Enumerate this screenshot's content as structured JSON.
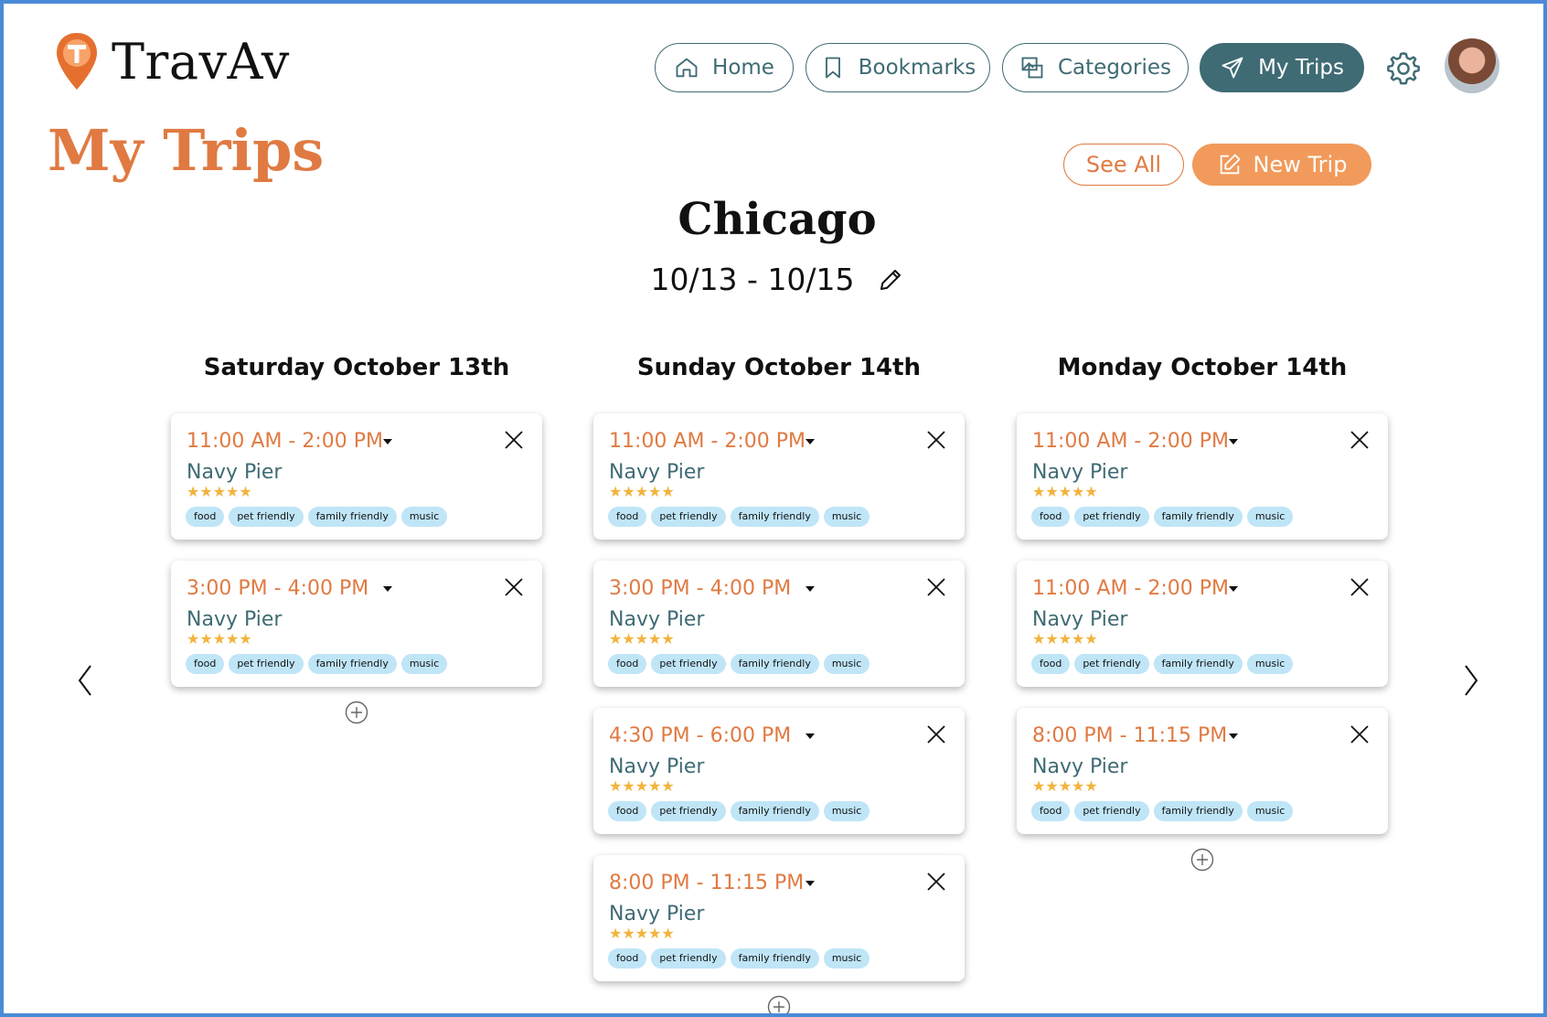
{
  "app": {
    "name": "TravAv"
  },
  "nav": {
    "home": "Home",
    "bookmarks": "Bookmarks",
    "categories": "Categories",
    "my_trips": "My Trips"
  },
  "page": {
    "title": "My Trips"
  },
  "actions": {
    "see_all": "See All",
    "new_trip": "New Trip"
  },
  "trip": {
    "city": "Chicago",
    "dates": "10/13 - 10/15"
  },
  "colors": {
    "accent": "#e07a42",
    "brand_teal": "#3f6b74",
    "tag_bg": "#bfe5f7",
    "star": "#f3b33d"
  },
  "days": [
    {
      "title": "Saturday October 13th",
      "events": [
        {
          "time": "11:00 AM - 2:00 PM",
          "name": "Navy Pier",
          "rating": 5,
          "stars": "★★★★★",
          "tags": [
            "food",
            "pet friendly",
            "family friendly",
            "music"
          ]
        },
        {
          "time": "3:00 PM - 4:00 PM",
          "name": "Navy Pier",
          "rating": 5,
          "stars": "★★★★★",
          "tags": [
            "food",
            "pet friendly",
            "family friendly",
            "music"
          ]
        }
      ]
    },
    {
      "title": "Sunday October 14th",
      "events": [
        {
          "time": "11:00 AM - 2:00 PM",
          "name": "Navy Pier",
          "rating": 5,
          "stars": "★★★★★",
          "tags": [
            "food",
            "pet friendly",
            "family friendly",
            "music"
          ]
        },
        {
          "time": "3:00 PM - 4:00 PM",
          "name": "Navy Pier",
          "rating": 5,
          "stars": "★★★★★",
          "tags": [
            "food",
            "pet friendly",
            "family friendly",
            "music"
          ]
        },
        {
          "time": "4:30 PM - 6:00 PM",
          "name": "Navy Pier",
          "rating": 5,
          "stars": "★★★★★",
          "tags": [
            "food",
            "pet friendly",
            "family friendly",
            "music"
          ]
        },
        {
          "time": "8:00 PM - 11:15 PM",
          "name": "Navy Pier",
          "rating": 5,
          "stars": "★★★★★",
          "tags": [
            "food",
            "pet friendly",
            "family friendly",
            "music"
          ]
        }
      ]
    },
    {
      "title": "Monday October 14th",
      "events": [
        {
          "time": "11:00 AM - 2:00 PM",
          "name": "Navy Pier",
          "rating": 5,
          "stars": "★★★★★",
          "tags": [
            "food",
            "pet friendly",
            "family friendly",
            "music"
          ]
        },
        {
          "time": "11:00 AM - 2:00 PM",
          "name": "Navy Pier",
          "rating": 5,
          "stars": "★★★★★",
          "tags": [
            "food",
            "pet friendly",
            "family friendly",
            "music"
          ]
        },
        {
          "time": "8:00 PM - 11:15 PM",
          "name": "Navy Pier",
          "rating": 5,
          "stars": "★★★★★",
          "tags": [
            "food",
            "pet friendly",
            "family friendly",
            "music"
          ]
        }
      ]
    }
  ]
}
